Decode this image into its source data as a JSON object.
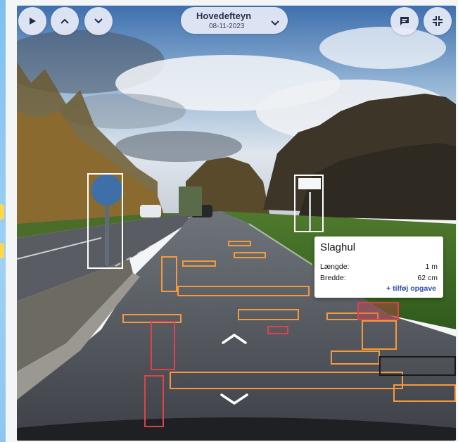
{
  "header": {
    "title": "Hovedefteyn",
    "date": "08-11-2023"
  },
  "toolbar": {
    "play_icon": "play-icon",
    "prev_icon": "chevron-up-icon",
    "next_icon": "chevron-down-icon",
    "comment_icon": "comment-icon",
    "collapse_icon": "collapse-icon"
  },
  "popup": {
    "title": "Slaghul",
    "rows": [
      {
        "label": "Længde:",
        "value": "1 m"
      },
      {
        "label": "Bredde:",
        "value": "62 cm"
      }
    ],
    "action": "+ tilføj opgave"
  },
  "colors": {
    "damage_orange": "#f59a3c",
    "damage_red": "#e0414a",
    "sign_white": "#ffffff",
    "accent_blue": "#2f4fae"
  }
}
